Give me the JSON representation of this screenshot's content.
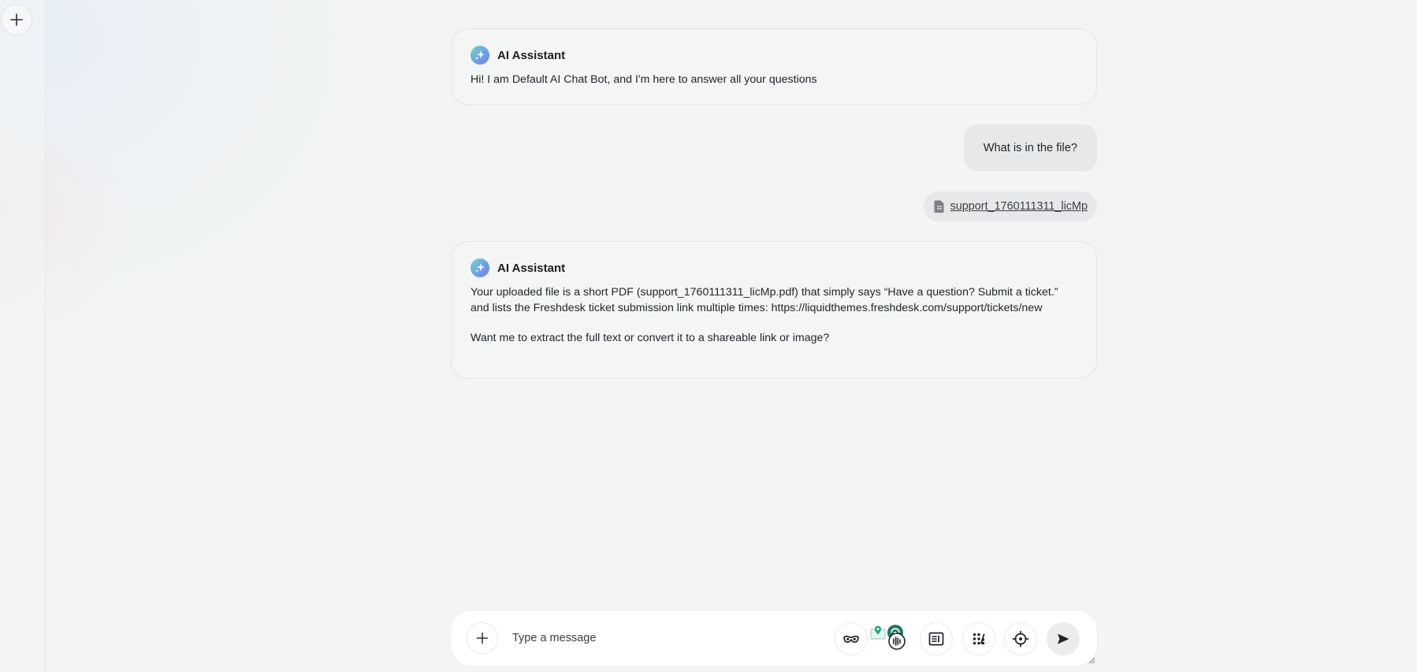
{
  "sidebar": {
    "new_chat_icon": "plus-icon"
  },
  "thread": {
    "greeting": {
      "name": "AI Assistant",
      "text": "Hi! I am Default AI Chat Bot, and I'm here to answer all your questions"
    },
    "user_message": "What is in the file?",
    "attachment": {
      "name": "support_1760111311_licMp",
      "icon": "document-icon"
    },
    "reply": {
      "name": "AI Assistant",
      "paragraph1": "Your uploaded file is a short PDF (support_1760111311_licMp.pdf) that simply says “Have a question? Submit a ticket.” and lists the Freshdesk ticket submission link multiple times: https://liquidthemes.freshdesk.com/support/tickets/new",
      "paragraph2": "Want me to extract the full text or convert it to a shareable link or image?"
    }
  },
  "composer": {
    "placeholder": "Type a message",
    "tools": [
      "incognito-mask-icon",
      "extension-icons",
      "reader-icon",
      "apps-grid-icon",
      "locate-target-icon",
      "send-icon"
    ]
  },
  "colors": {
    "avatar_gradient_start": "#7ed4b8",
    "avatar_gradient_end": "#7b78e6"
  }
}
